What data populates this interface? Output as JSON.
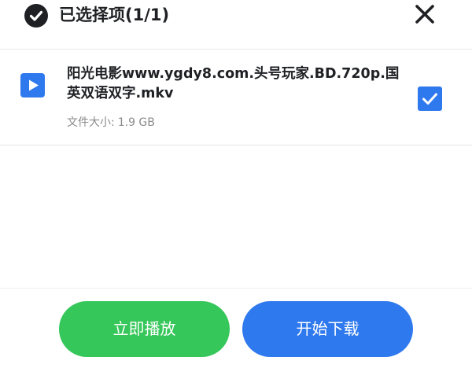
{
  "header": {
    "title": "已选择项(1/1)",
    "check_icon": "check-circle-icon",
    "close_icon": "close-icon"
  },
  "file": {
    "name": "阳光电影www.ygdy8.com.头号玩家.BD.720p.国英双语双字.mkv",
    "size_label": "文件大小:",
    "size_value": "1.9 GB",
    "icon": "video-play-icon",
    "selected": true
  },
  "actions": {
    "play_label": "立即播放",
    "download_label": "开始下载"
  },
  "colors": {
    "accent_blue": "#2f79ee",
    "play_green": "#35c759",
    "text_dark": "#1f2024",
    "text_muted": "#8a8a8a"
  }
}
